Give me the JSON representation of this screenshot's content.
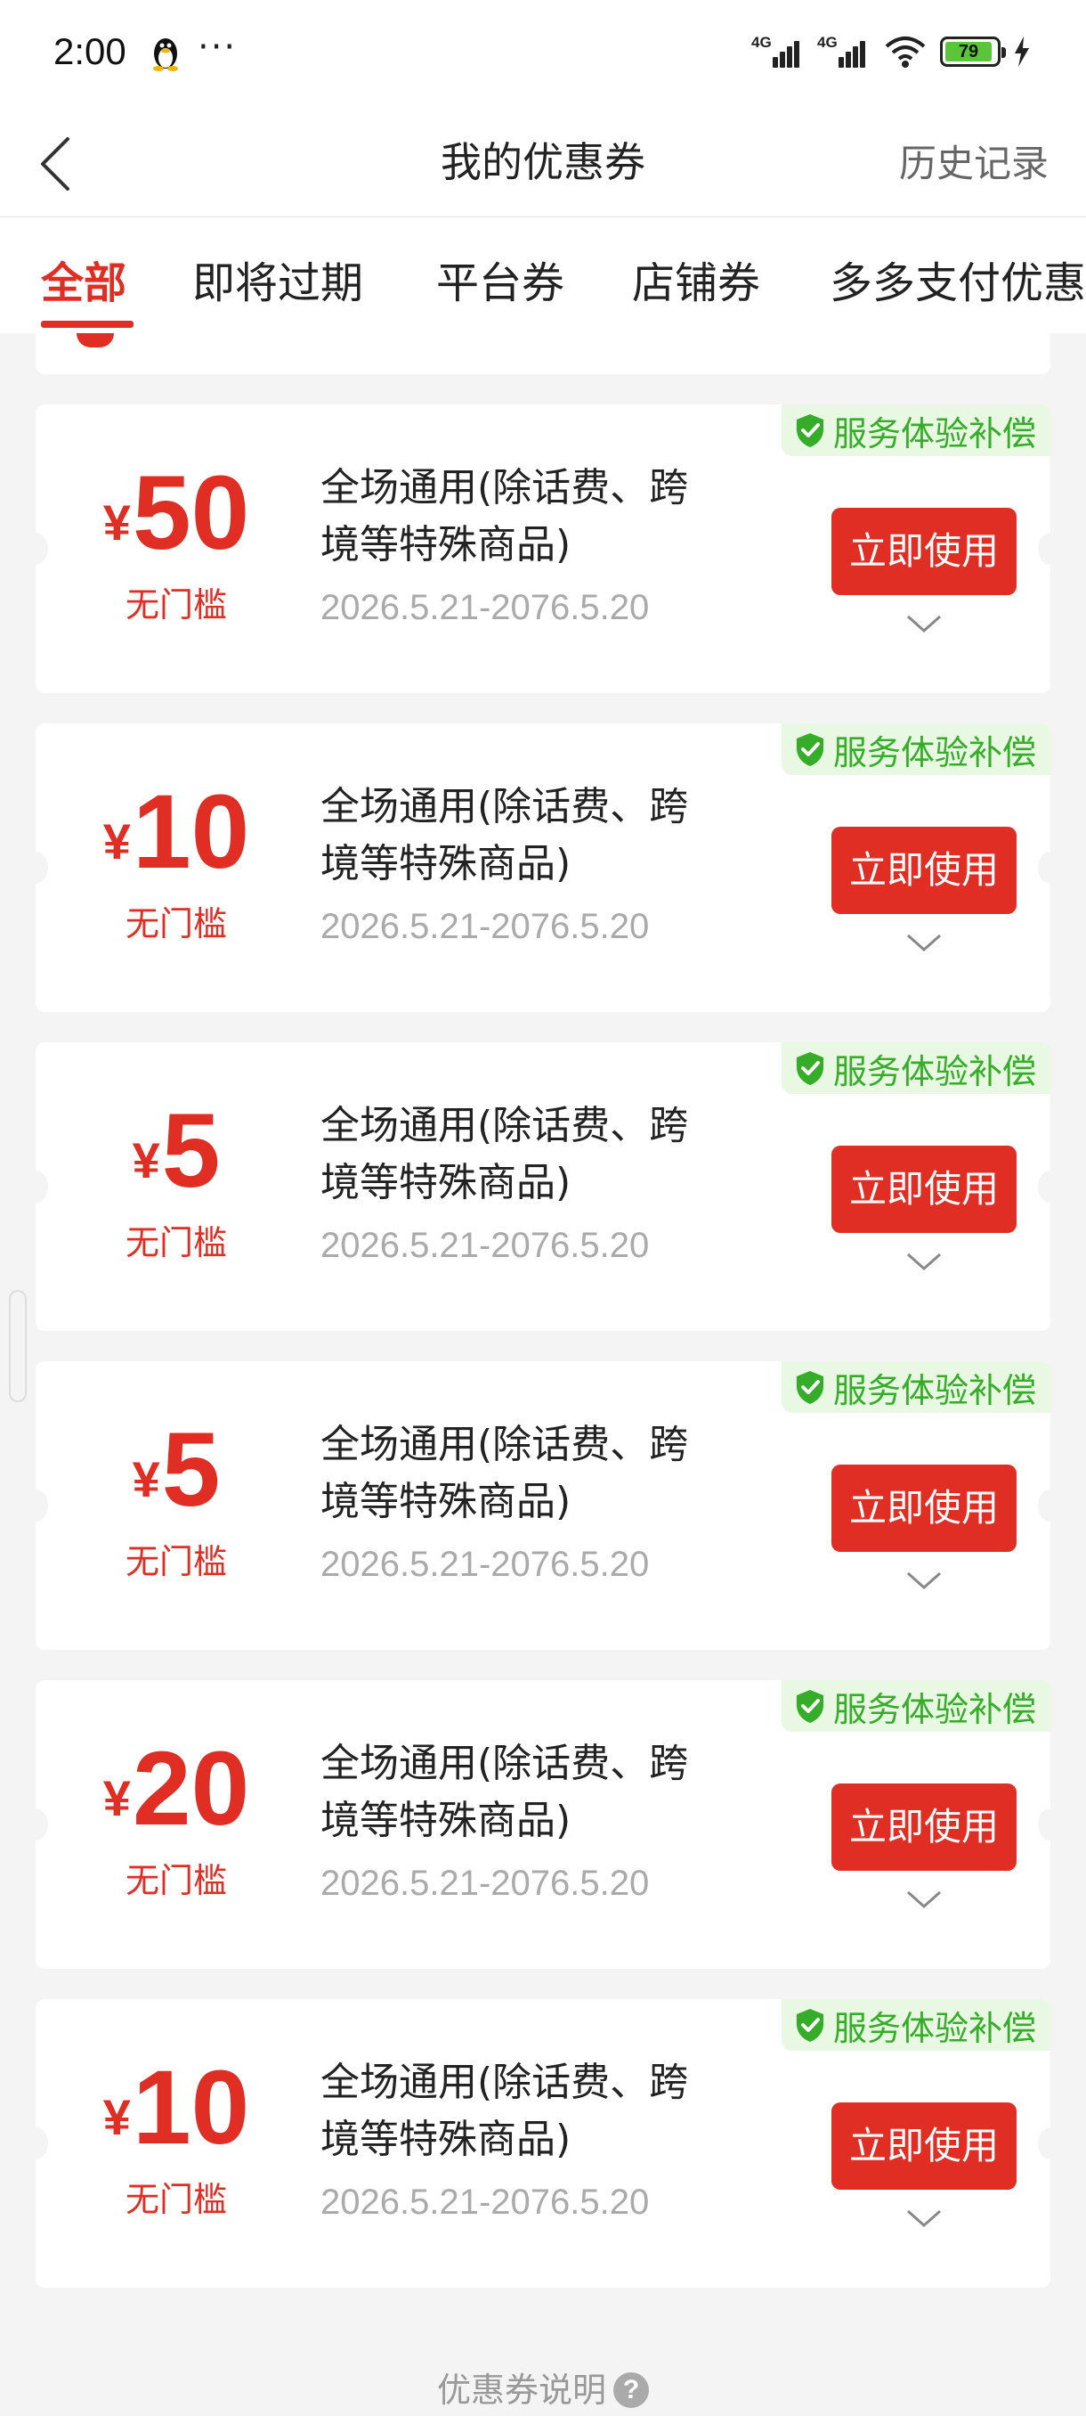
{
  "status_bar": {
    "time": "2:00",
    "more": "···",
    "signal_1": "4G",
    "signal_2": "4G",
    "battery": "79"
  },
  "nav": {
    "title": "我的优惠券",
    "history": "历史记录"
  },
  "tabs": [
    {
      "label": "全部",
      "active": true
    },
    {
      "label": "即将过期",
      "active": false
    },
    {
      "label": "平台券",
      "active": false
    },
    {
      "label": "店铺券",
      "active": false
    },
    {
      "label": "多多支付优惠",
      "active": false
    }
  ],
  "coupons": [
    {
      "currency": "¥",
      "amount": "50",
      "threshold": "无门槛",
      "desc_line1": "全场通用(除话费、跨",
      "desc_line2": "境等特殊商品)",
      "date": "2026.5.21-2076.5.20",
      "button": "立即使用",
      "badge": "服务体验补偿"
    },
    {
      "currency": "¥",
      "amount": "10",
      "threshold": "无门槛",
      "desc_line1": "全场通用(除话费、跨",
      "desc_line2": "境等特殊商品)",
      "date": "2026.5.21-2076.5.20",
      "button": "立即使用",
      "badge": "服务体验补偿"
    },
    {
      "currency": "¥",
      "amount": "5",
      "threshold": "无门槛",
      "desc_line1": "全场通用(除话费、跨",
      "desc_line2": "境等特殊商品)",
      "date": "2026.5.21-2076.5.20",
      "button": "立即使用",
      "badge": "服务体验补偿"
    },
    {
      "currency": "¥",
      "amount": "5",
      "threshold": "无门槛",
      "desc_line1": "全场通用(除话费、跨",
      "desc_line2": "境等特殊商品)",
      "date": "2026.5.21-2076.5.20",
      "button": "立即使用",
      "badge": "服务体验补偿"
    },
    {
      "currency": "¥",
      "amount": "20",
      "threshold": "无门槛",
      "desc_line1": "全场通用(除话费、跨",
      "desc_line2": "境等特殊商品)",
      "date": "2026.5.21-2076.5.20",
      "button": "立即使用",
      "badge": "服务体验补偿"
    },
    {
      "currency": "¥",
      "amount": "10",
      "threshold": "无门槛",
      "desc_line1": "全场通用(除话费、跨",
      "desc_line2": "境等特殊商品)",
      "date": "2026.5.21-2076.5.20",
      "button": "立即使用",
      "badge": "服务体验补偿"
    }
  ],
  "footer": {
    "label": "优惠券说明",
    "icon": "?"
  },
  "colors": {
    "accent": "#e02e24",
    "badge_green": "#35ad28",
    "badge_bg": "#e9f8e3"
  }
}
